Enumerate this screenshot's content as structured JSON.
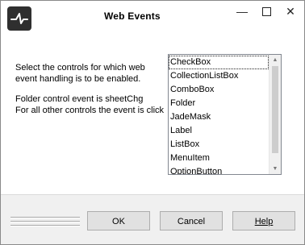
{
  "window": {
    "title": "Web Events",
    "controls": {
      "minimize": "—",
      "maximize": "",
      "close": "✕"
    }
  },
  "description": {
    "line1": "Select the controls for which web",
    "line2": "event handling is to be enabled.",
    "line3": "Folder control event is sheetChg",
    "line4": "For all other controls the event is click"
  },
  "controls_list": {
    "items": [
      "CheckBox",
      "CollectionListBox",
      "ComboBox",
      "Folder",
      "JadeMask",
      "Label",
      "ListBox",
      "MenuItem",
      "OptionButton"
    ],
    "selected": "CheckBox",
    "scroll_up": "▲",
    "scroll_down": "▼"
  },
  "buttons": {
    "ok": "OK",
    "cancel": "Cancel",
    "help": "Help"
  },
  "colors": {
    "title_bg": "#ffffff",
    "dialog_bg": "#f0f0f0",
    "button_bg": "#e1e1e1",
    "icon_bg": "#2f2f2f"
  },
  "icons": {
    "app": "jade-app-icon"
  }
}
